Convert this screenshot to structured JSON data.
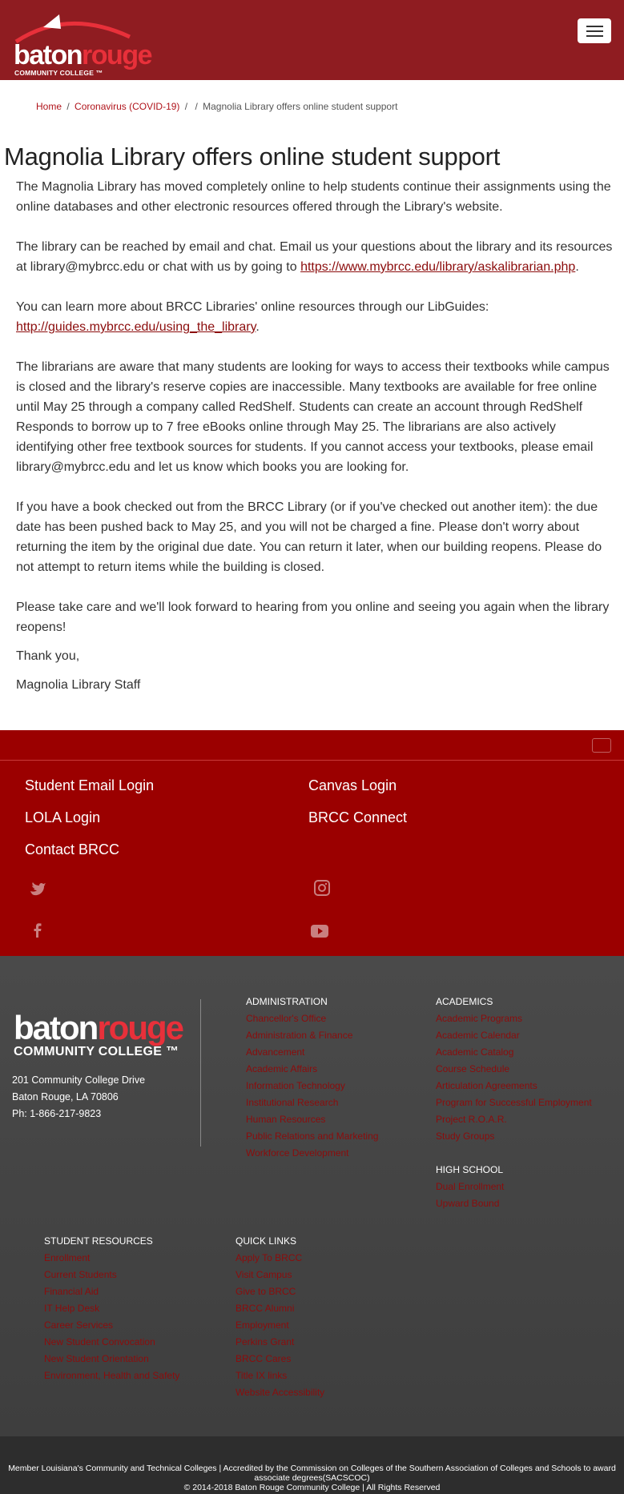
{
  "header": {
    "logo_word1": "baton",
    "logo_word2": "rouge",
    "logo_sub": "COMMUNITY COLLEGE",
    "logo_tm": "™"
  },
  "breadcrumb": {
    "home": "Home",
    "section": "Coronavirus (COVID-19)",
    "sep": "/",
    "current": "Magnolia Library offers online student support"
  },
  "article": {
    "title": "Magnolia Library offers online student support",
    "p1": "The Magnolia Library has moved completely online to help students continue their assignments using the online databases and other electronic resources offered through the Library's website.",
    "p2_before": "The library can be reached by email and chat. Email us your questions about the library and its resources at library@mybrcc.edu or chat with us by going to ",
    "p2_link": "https://www.mybrcc.edu/library/askalibrarian.php",
    "p2_after": ".",
    "p3_before": "You can learn more about BRCC Libraries' online resources through our LibGuides: ",
    "p3_link": "http://guides.mybrcc.edu/using_the_library",
    "p3_after": ".",
    "p4": "The librarians are aware that many students are looking for ways to access their textbooks while campus is closed and the library's reserve copies are inaccessible. Many textbooks are available for free online until May 25 through a company called RedShelf. Students can create an account through RedShelf Responds to borrow up to 7 free eBooks online through May 25. The librarians are also actively identifying other free textbook sources for students. If you cannot access your textbooks, please email library@mybrcc.edu and let us know which books you are looking for.",
    "p5": "If you have a book checked out from the BRCC Library (or if you've checked out another item): the due date has been pushed back to May 25, and you will not be charged a fine. Please don't worry about returning the item by the original due date. You can return it later, when our building reopens. Please do not attempt to return items while the building is closed.",
    "p6": "Please take care and we'll look forward to hearing from you online and seeing you again when the library reopens!",
    "p7": "Thank you,",
    "p8": "Magnolia Library Staff"
  },
  "quick_links": {
    "student_email": "Student Email Login",
    "canvas": "Canvas Login",
    "lola": "LOLA Login",
    "brcc_connect": "BRCC Connect",
    "contact": "Contact BRCC"
  },
  "footer": {
    "logo_word1": "baton",
    "logo_word2": "rouge",
    "logo_sub": "COMMUNITY COLLEGE",
    "logo_tm": "™",
    "address1": "201 Community College Drive",
    "address2": "Baton Rouge, LA 70806",
    "phone": "Ph: 1-866-217-9823",
    "administration": {
      "head": "ADMINISTRATION",
      "items": [
        "Chancellor's Office",
        "Administration & Finance",
        "Advancement",
        "Academic Affairs",
        "Information Technology",
        "Institutional Research",
        "Human Resources",
        "Public Relations and Marketing",
        "Workforce Development"
      ]
    },
    "academics": {
      "head": "ACADEMICS",
      "items": [
        "Academic Programs",
        "Academic Calendar",
        "Academic Catalog",
        "Course Schedule",
        "Articulation Agreements",
        "Program for Successful Employment",
        "Project R.O.A.R.",
        "Study Groups"
      ]
    },
    "high_school": {
      "head": "HIGH SCHOOL",
      "items": [
        "Dual Enrollment",
        "Upward Bound"
      ]
    },
    "student_resources": {
      "head": "STUDENT RESOURCES",
      "items": [
        "Enrollment",
        "Current Students",
        "Financial Aid",
        "IT Help Desk",
        "Career Services",
        "New Student Convocation",
        "New Student Orientation",
        "Environment, Health and Safety"
      ]
    },
    "quick": {
      "head": "QUICK LINKS",
      "items": [
        "Apply To BRCC",
        "Visit Campus",
        "Give to BRCC",
        "BRCC Alumni",
        "Employment",
        "Perkins Grant",
        "BRCC Cares",
        "Title IX links",
        "Website Accessibility"
      ]
    },
    "bottom_line1": "Member Louisiana's Community and Technical Colleges  | Accredited by the Commission on Colleges of the Southern Association of Colleges and Schools to award associate degrees(SACSCOC)",
    "bottom_line2": "© 2014-2018 Baton Rouge Community College  |  All Rights Reserved"
  },
  "icons": {
    "twitter": "twitter-icon",
    "instagram": "instagram-icon",
    "facebook": "facebook-icon",
    "youtube": "youtube-icon",
    "menu": "hamburger-menu-icon"
  },
  "colors": {
    "header_bg": "#8f1c21",
    "band_bg": "#9b0000",
    "footer_bg": "#444444",
    "accent": "#e8303a",
    "link": "#8b0c0c"
  }
}
